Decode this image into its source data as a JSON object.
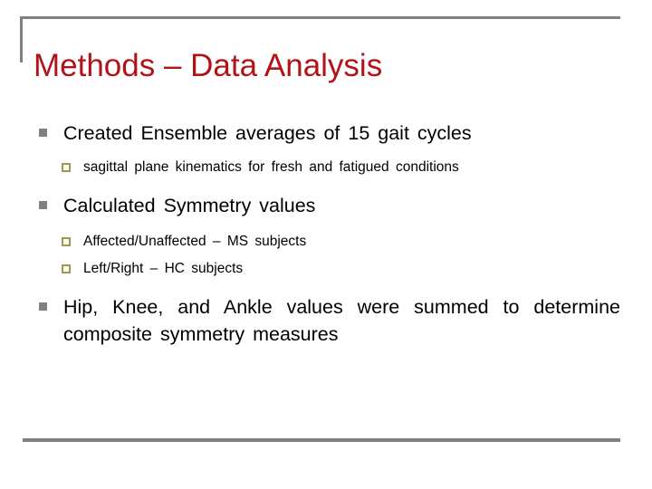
{
  "slide": {
    "title": "Methods – Data Analysis",
    "title_color": "#b01419",
    "rule_color": "#808080",
    "bullet_level1_color": "#808080",
    "bullet_level2_color": "#9a9a4a",
    "background": "#ffffff",
    "body": [
      {
        "level": 1,
        "text": "Created Ensemble averages of 15 gait cycles"
      },
      {
        "level": 2,
        "text": "sagittal plane kinematics for fresh and fatigued conditions"
      },
      {
        "level": 1,
        "text": "Calculated Symmetry values"
      },
      {
        "level": 2,
        "text": "Affected/Unaffected – MS subjects"
      },
      {
        "level": 2,
        "text": "Left/Right – HC subjects"
      },
      {
        "level": 1,
        "text": "Hip, Knee, and Ankle values were summed to determine composite symmetry measures"
      }
    ]
  }
}
